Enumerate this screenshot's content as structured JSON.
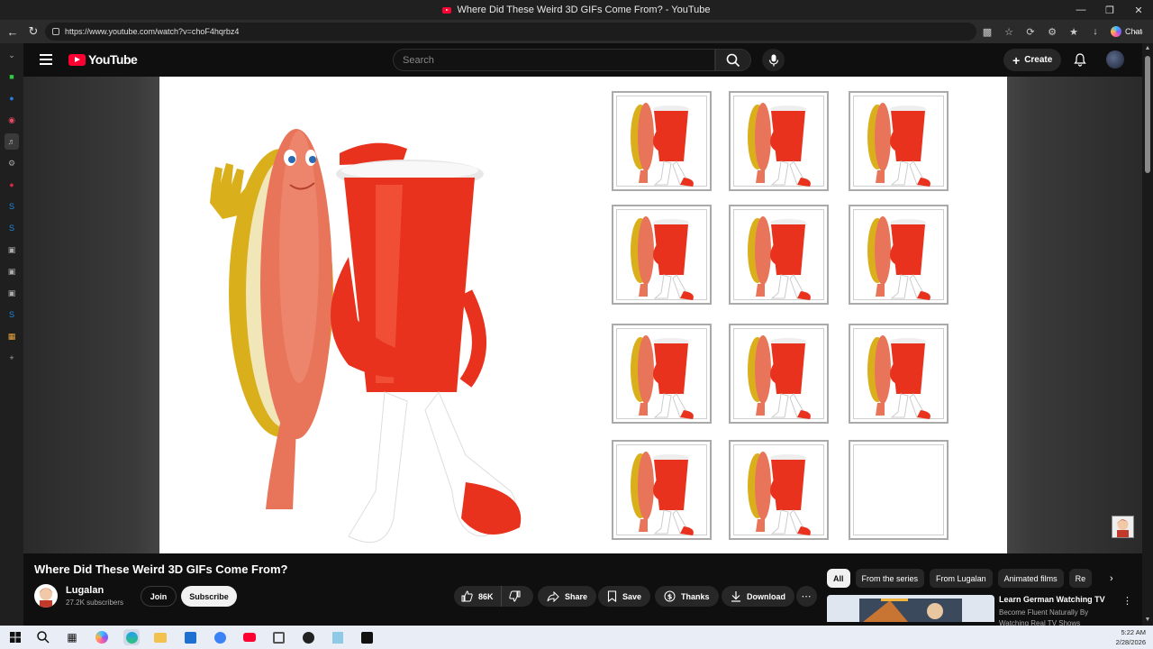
{
  "browser": {
    "tab_title": "Where Did These Weird 3D GIFs Come From? - YouTube",
    "url": "https://www.youtube.com/watch?v=choF4hqrbz4",
    "chat_label": "Chat",
    "window_controls": [
      "—",
      "❐",
      "✕"
    ]
  },
  "header": {
    "logo_text": "YouTube",
    "search_placeholder": "Search",
    "create_label": "Create"
  },
  "video": {
    "title": "Where Did These Weird 3D GIFs Come From?",
    "channel_name": "Lugalan",
    "subscribers": "27.2K subscribers",
    "join_label": "Join",
    "subscribe_label": "Subscribe",
    "likes": "86K",
    "share_label": "Share",
    "save_label": "Save",
    "thanks_label": "Thanks",
    "download_label": "Download"
  },
  "chips": [
    "All",
    "From the series",
    "From Lugalan",
    "Animated films",
    "Re"
  ],
  "recommendation": {
    "title": "Learn German Watching TV",
    "subtitle": "Become Fluent Naturally By Watching Real TV Shows"
  },
  "taskbar": {
    "time": "5:22 AM",
    "date": "2/28/2026"
  },
  "colors": {
    "yt_red": "#ff0033",
    "cup_red": "#e8321e",
    "hotdog_bun": "#d9b01c",
    "hotdog_sausage": "#e8745a"
  },
  "icons": {
    "sidebar": [
      "chevron-down-icon",
      "green-app-icon",
      "circle-icon",
      "record-icon",
      "speaker-icon",
      "gear-icon",
      "app-icon",
      "skype-icon",
      "app-icon",
      "app-icon",
      "app-icon",
      "skype-icon",
      "office-icon",
      "plus-icon"
    ]
  }
}
